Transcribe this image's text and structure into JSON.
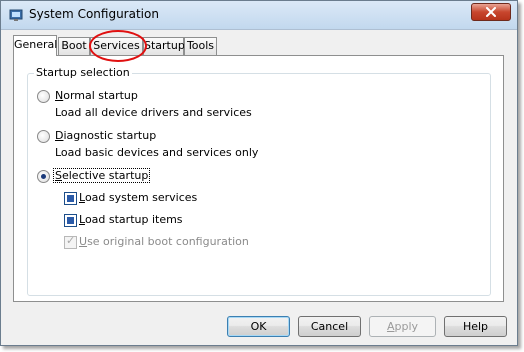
{
  "window": {
    "title": "System Configuration",
    "app_icon": "msconfig-icon",
    "close_glyph": "✕"
  },
  "tabs": [
    {
      "label": "General",
      "active": true
    },
    {
      "label": "Boot",
      "active": false
    },
    {
      "label": "Services",
      "active": false,
      "highlighted": true
    },
    {
      "label": "Startup",
      "active": false
    },
    {
      "label": "Tools",
      "active": false
    }
  ],
  "startup_selection": {
    "title": "Startup selection",
    "normal": {
      "label_hotkey": "N",
      "label_rest": "ormal startup",
      "description": "Load all device drivers and services",
      "selected": false
    },
    "diagnostic": {
      "label_hotkey": "D",
      "label_rest": "iagnostic startup",
      "description": "Load basic devices and services only",
      "selected": false
    },
    "selective": {
      "label_hotkey": "S",
      "label_rest": "elective startup",
      "selected": true
    },
    "load_system_services": {
      "label_hotkey": "L",
      "label_rest": "oad system services",
      "checked": "indeterminate"
    },
    "load_startup_items": {
      "label_hotkey": "L",
      "label_rest": "oad startup items",
      "checked": "indeterminate"
    },
    "use_original_boot": {
      "label_hotkey": "U",
      "label_rest": "se original boot configuration",
      "checked": true,
      "disabled": true
    }
  },
  "buttons": {
    "ok": "OK",
    "cancel": "Cancel",
    "apply_hotkey": "A",
    "apply_rest": "pply",
    "help": "Help"
  },
  "colors": {
    "close_button": "#c8462e",
    "callout_circle": "#e01010",
    "checkbox_fill": "#2a5aa8"
  }
}
